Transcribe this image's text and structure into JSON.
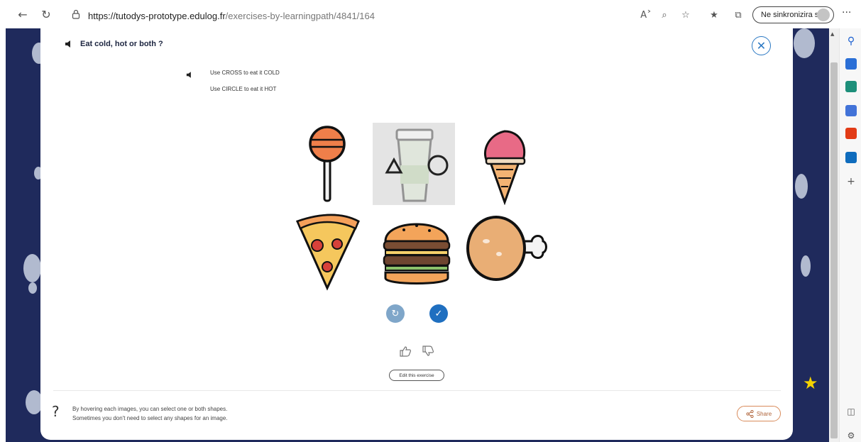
{
  "browser": {
    "url_host": "https://tutodys-prototype.edulog.fr",
    "url_path": "/exercises-by-learningpath/4841/164",
    "sync_label": "Ne sinkronizira se",
    "more_label": "···"
  },
  "exercise": {
    "title": "Eat cold, hot or both ?",
    "instructions": [
      "Use CROSS to eat it COLD",
      "Use CIRCLE to eat it HOT"
    ],
    "items": [
      {
        "name": "lollipop",
        "selected": false
      },
      {
        "name": "iced-coffee-cup",
        "selected": true
      },
      {
        "name": "ice-cream-cone",
        "selected": false
      },
      {
        "name": "pizza-slice",
        "selected": false
      },
      {
        "name": "burger",
        "selected": false
      },
      {
        "name": "chicken-drumstick",
        "selected": false
      }
    ],
    "edit_label": "Edit this exercise",
    "help_lines": [
      "By hovering each images, you can select one or both shapes.",
      "Sometimes you don't need to select any shapes for an image."
    ],
    "share_label": "Share",
    "help_symbol": "?"
  },
  "colors": {
    "page_background": "#1f2a5c",
    "accent_blue": "#2a78c3",
    "reset_button": "#7fa6c9",
    "validate_button": "#1f6fc0",
    "share_border": "#d98b5b",
    "star": "#f5d300"
  }
}
